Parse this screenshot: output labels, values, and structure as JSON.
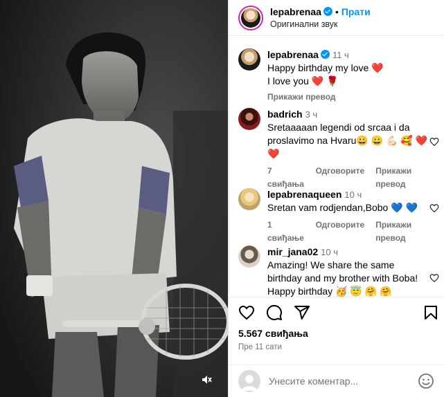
{
  "post": {
    "author": "lepabrenaa",
    "follow_label": "Прати",
    "audio_label": "Оригинални звук",
    "likes": "5.567 свиђања",
    "posted_time": "Пре 11 сати",
    "comment_placeholder": "Унесите коментар..."
  },
  "comments": [
    {
      "user": "lepabrenaa",
      "time": "11 ч",
      "verified": true,
      "line1": "Happy birthday my love ❤️",
      "line2": "I love you ❤️ 🌹",
      "translate_label": "Прикажи превод"
    },
    {
      "user": "badrich",
      "time": "3 ч",
      "line1": "Sretaaaaan legendi od srcaa i da",
      "line2": "proslavimo na Hvaru😀 😀 💪🏻 🥰 ❤️",
      "line3": "❤️",
      "likes_label": "7 свиђања",
      "reply_label": "Одговорите",
      "translate_label": "Прикажи превод"
    },
    {
      "user": "lepabrenaqueen",
      "time": "10 ч",
      "line1": "Sretan vam rodjendan,Bobo 💙 💙",
      "likes_label": "1 свиђање",
      "reply_label": "Одговорите",
      "translate_label": "Прикажи превод"
    },
    {
      "user": "mir_jana02",
      "time": "10 ч",
      "line1": "Amazing! We share the same",
      "line2": "birthday and my brother with Boba!",
      "line3": "Happy birthday 🥳 😇 🤗 🤗"
    }
  ],
  "icons": [
    "heart-icon",
    "comment-icon",
    "share-icon",
    "bookmark-icon",
    "mute-icon",
    "emoji-icon"
  ],
  "colors": {
    "accent": "#0095f6",
    "like": "#ed4956",
    "muted": "#737373"
  }
}
